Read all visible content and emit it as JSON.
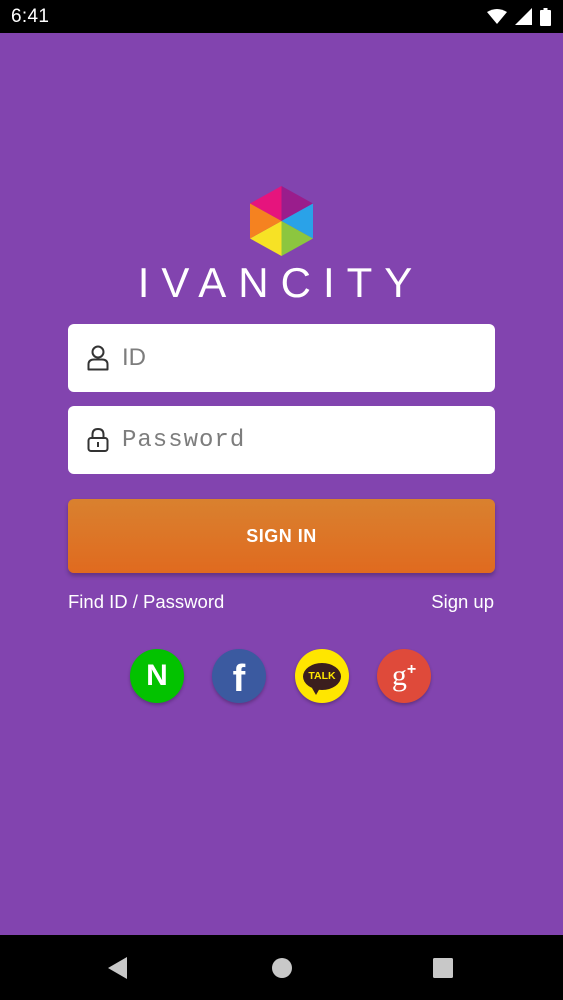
{
  "status_bar": {
    "time": "6:41",
    "icons": [
      "wifi-icon",
      "signal-icon",
      "battery-icon"
    ]
  },
  "app": {
    "brand": "IVANCITY",
    "colors": {
      "background": "#8244af",
      "signin_button": "#e06a1f",
      "naver": "#03c200",
      "facebook": "#3b5aa0",
      "kakao": "#ffe600",
      "google": "#df4a3a"
    },
    "login": {
      "id_placeholder": "ID",
      "id_icon": "user-icon",
      "password_placeholder": "Password",
      "password_icon": "lock-icon",
      "signin_label": "SIGN IN"
    },
    "links": {
      "find_label": "Find ID / Password",
      "signup_label": "Sign up"
    },
    "social": {
      "naver_glyph": "N",
      "facebook_glyph": "f",
      "kakao_glyph": "TALK",
      "google_glyph": "g",
      "google_plus": "+"
    }
  },
  "nav_bar": {
    "buttons": [
      "back-icon",
      "home-icon",
      "recents-icon"
    ]
  }
}
